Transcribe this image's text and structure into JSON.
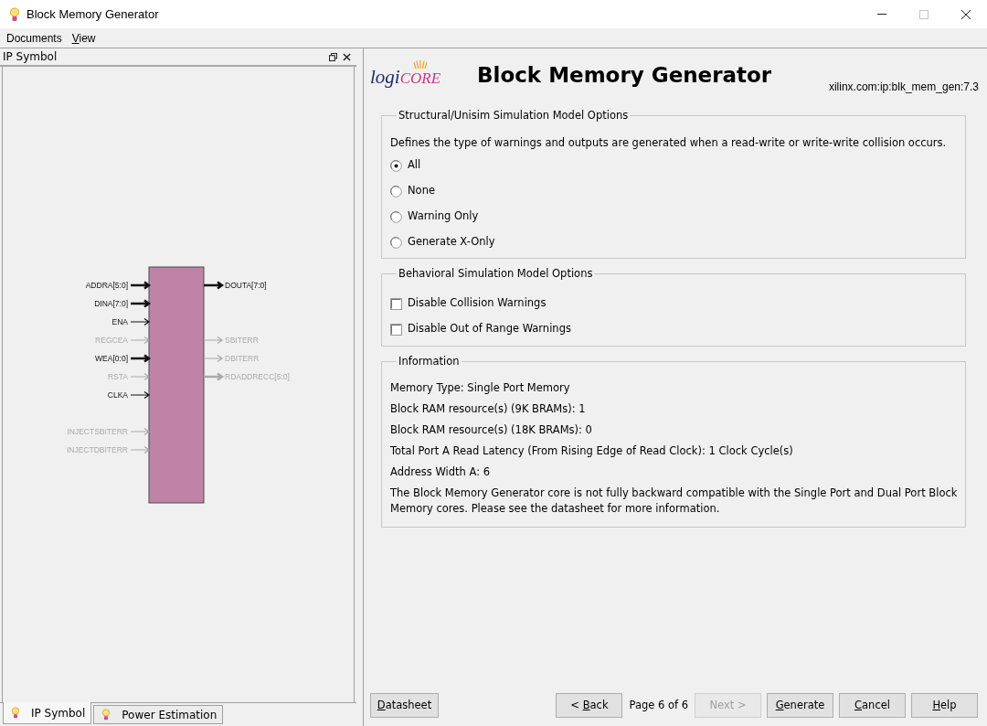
{
  "window": {
    "title": "Block Memory Generator",
    "maximize_enabled": false
  },
  "menu": [
    {
      "label": "Documents",
      "mnemonic": false
    },
    {
      "label": "View",
      "mnemonic": true
    }
  ],
  "left_panel": {
    "title": "IP Symbol",
    "symbol": {
      "left_groups": [
        [
          {
            "name": "ADDRA[5:0]",
            "bus": true,
            "enabled": true
          },
          {
            "name": "DINA[7:0]",
            "bus": true,
            "enabled": true
          },
          {
            "name": "ENA",
            "bus": false,
            "enabled": true
          },
          {
            "name": "REGCEA",
            "bus": false,
            "enabled": false
          },
          {
            "name": "WEA[0:0]",
            "bus": true,
            "enabled": true
          },
          {
            "name": "RSTA",
            "bus": false,
            "enabled": false
          },
          {
            "name": "CLKA",
            "bus": false,
            "enabled": true
          }
        ],
        [
          {
            "name": "INJECTSBITERR",
            "bus": false,
            "enabled": false
          },
          {
            "name": "INJECTDBITERR",
            "bus": false,
            "enabled": false
          }
        ]
      ],
      "right_groups": [
        [
          {
            "name": "DOUTA[7:0]",
            "bus": true,
            "enabled": true
          }
        ],
        [
          {
            "name": "SBITERR",
            "bus": false,
            "enabled": false
          },
          {
            "name": "DBITERR",
            "bus": false,
            "enabled": false
          },
          {
            "name": "RDADDRECC[5:0]",
            "bus": true,
            "enabled": false
          }
        ]
      ]
    },
    "tabs": [
      {
        "label": "IP Symbol",
        "selected": true
      },
      {
        "label": "Power Estimation",
        "selected": false
      }
    ]
  },
  "header": {
    "logo": [
      "logi",
      "CORE"
    ],
    "title": "Block Memory Generator",
    "version": "xilinx.com:ip:blk_mem_gen:7.3"
  },
  "groups": [
    {
      "kind": "radio",
      "title": "Structural/Unisim Simulation Model Options",
      "description": "Defines the type of warnings and outputs are generated when a read-write or write-write collision occurs.",
      "options": [
        {
          "label": "All",
          "selected": true
        },
        {
          "label": "None",
          "selected": false
        },
        {
          "label": "Warning Only",
          "selected": false
        },
        {
          "label": "Generate X-Only",
          "selected": false
        }
      ]
    },
    {
      "kind": "checkbox",
      "title": "Behavioral Simulation Model Options",
      "options": [
        {
          "label": "Disable Collision Warnings",
          "checked": false
        },
        {
          "label": "Disable Out of Range Warnings",
          "checked": false
        }
      ]
    },
    {
      "kind": "info",
      "title": "Information",
      "lines": [
        "Memory Type: Single Port Memory",
        "Block RAM resource(s) (9K BRAMs): 1",
        "Block RAM resource(s) (18K BRAMs): 0",
        "Total Port A Read Latency (From Rising Edge of Read Clock): 1 Clock Cycle(s)",
        "Address Width A: 6",
        "The Block Memory Generator core is not fully backward compatible with the Single Port and Dual Port Block Memory cores. Please see the datasheet for more information."
      ]
    }
  ],
  "footer": {
    "datasheet": {
      "label": "Datasheet",
      "mnemonic": true
    },
    "nav": [
      {
        "kind": "button",
        "label": "< Back",
        "disabled": false,
        "mnemonic": true
      },
      {
        "kind": "text",
        "label": "Page 6 of 6"
      },
      {
        "kind": "button",
        "label": "Next >",
        "disabled": true,
        "mnemonic": false
      },
      {
        "kind": "button",
        "label": "Generate",
        "disabled": false,
        "mnemonic": true
      },
      {
        "kind": "button",
        "label": "Cancel",
        "disabled": false,
        "mnemonic": true
      },
      {
        "kind": "button",
        "label": "Help",
        "disabled": false,
        "mnemonic": true
      }
    ]
  }
}
